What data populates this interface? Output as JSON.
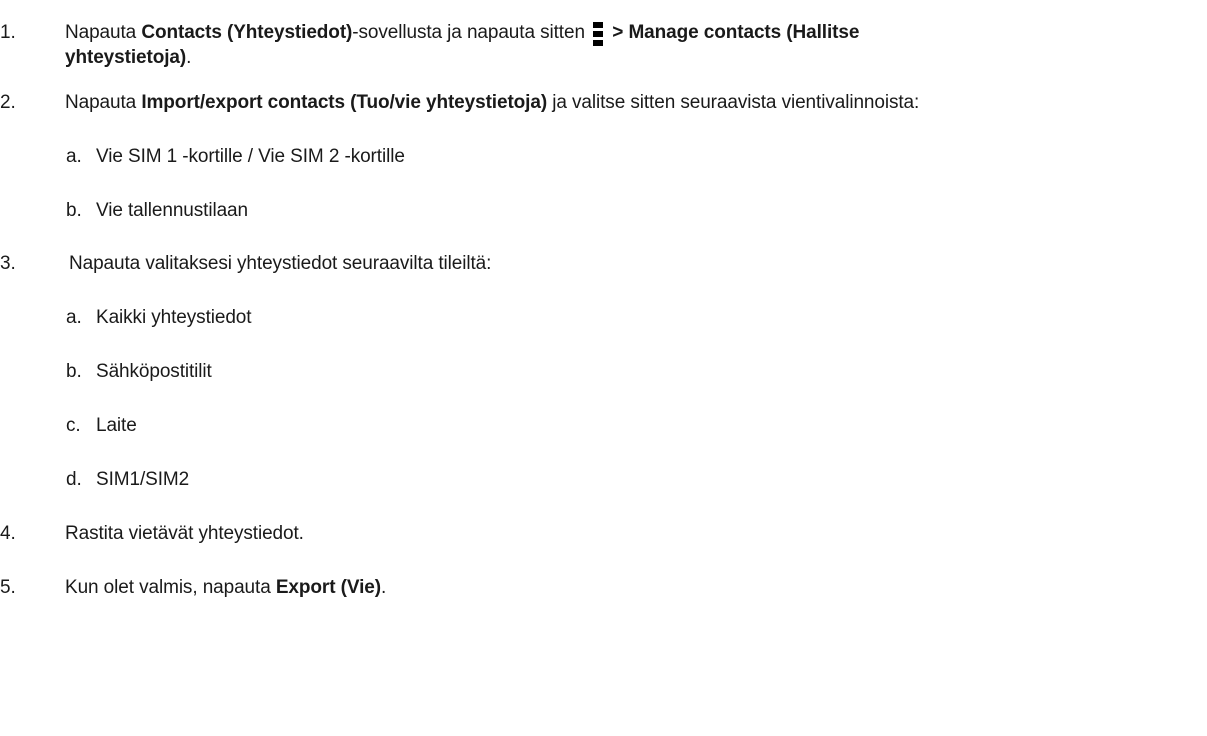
{
  "steps": [
    {
      "number": "1.",
      "parts": {
        "p1": "Napauta ",
        "b1": "Contacts (Yhteystiedot)",
        "p2": "-sovellusta ja napauta sitten ",
        "b2": " > Manage contacts (Hallitse",
        "b3": "yhteystietoja)",
        "p3": "."
      },
      "icon": "menu-icon"
    },
    {
      "number": "2.",
      "parts": {
        "p1": "Napauta ",
        "b1": "Import/export contacts (Tuo/vie yhteystietoja)",
        "p2": " ja valitse sitten seuraavista vientivalinnoista:"
      },
      "substeps": [
        {
          "letter": "a.",
          "text": "Vie SIM 1 -kortille / Vie SIM 2 -kortille"
        },
        {
          "letter": "b.",
          "text": "Vie tallennustilaan"
        }
      ]
    },
    {
      "number": "3.",
      "text": "Napauta valitaksesi yhteystiedot seuraavilta tileiltä:",
      "substeps": [
        {
          "letter": "a.",
          "text": "Kaikki yhteystiedot"
        },
        {
          "letter": "b.",
          "text": "Sähköpostitilit"
        },
        {
          "letter": "c.",
          "text": "Laite"
        },
        {
          "letter": "d.",
          "text": "SIM1/SIM2"
        }
      ]
    },
    {
      "number": "4.",
      "text": "Rastita vietävät yhteystiedot."
    },
    {
      "number": "5.",
      "parts": {
        "p1": "Kun olet valmis, napauta ",
        "b1": "Export (Vie)",
        "p2": "."
      }
    }
  ]
}
